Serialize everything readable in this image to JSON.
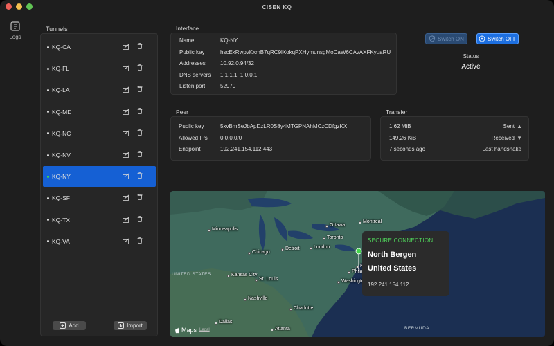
{
  "app": {
    "title": "CISEN KQ"
  },
  "sidebar": {
    "logs_label": "Logs"
  },
  "tunnels": {
    "label": "Tunnels",
    "items": [
      {
        "name": "KQ-CA",
        "active": false
      },
      {
        "name": "KQ-FL",
        "active": false
      },
      {
        "name": "KQ-LA",
        "active": false
      },
      {
        "name": "KQ-MD",
        "active": false
      },
      {
        "name": "KQ-NC",
        "active": false
      },
      {
        "name": "KQ-NV",
        "active": false
      },
      {
        "name": "KQ-NY",
        "active": true
      },
      {
        "name": "KQ-SF",
        "active": false
      },
      {
        "name": "KQ-TX",
        "active": false
      },
      {
        "name": "KQ-VA",
        "active": false
      }
    ],
    "add_label": "Add",
    "import_label": "Import"
  },
  "interface": {
    "label": "Interface",
    "rows": [
      {
        "key": "Name",
        "value": "KQ-NY"
      },
      {
        "key": "Public key",
        "value": "hscEkRwpvKxmB7qRC9lXokqPXHymunsgMoCaW6CAvAXFKyuaRU"
      },
      {
        "key": "Addresses",
        "value": "10.92.0.94/32"
      },
      {
        "key": "DNS servers",
        "value": "1.1.1.1, 1.0.0.1"
      },
      {
        "key": "Listen port",
        "value": "52970"
      }
    ]
  },
  "controls": {
    "switch_on_label": "Switch ON",
    "switch_off_label": "Switch OFF",
    "status_label": "Status",
    "status_value": "Active"
  },
  "peer": {
    "label": "Peer",
    "rows": [
      {
        "key": "Public key",
        "value": "5xvBmSeJbApDzLR0S8y4MTGPNAhMCzCDfgzKX"
      },
      {
        "key": "Allowed IPs",
        "value": "0.0.0.0/0"
      },
      {
        "key": "Endpoint",
        "value": "192.241.154.112:443"
      }
    ]
  },
  "transfer": {
    "label": "Transfer",
    "rows": [
      {
        "value": "1.62 MiB",
        "key": "Sent",
        "arrow": "▲"
      },
      {
        "value": "149.26 KiB",
        "key": "Received",
        "arrow": "▼"
      },
      {
        "value": "7 seconds ago",
        "key": "Last handshake",
        "arrow": ""
      }
    ]
  },
  "map": {
    "cities": [
      "Minneapolis",
      "Ottawa",
      "Montreal",
      "Toronto",
      "Detroit",
      "London",
      "Chicago",
      "Kansas City",
      "St. Louis",
      "Nashville",
      "Charlotte",
      "Dallas",
      "Atlanta",
      "Boston",
      "New York",
      "Philadelphia",
      "Washington"
    ],
    "regions": [
      "UNITED STATES",
      "BERMUDA"
    ],
    "callout": {
      "status": "SECURE CONNECTION",
      "city": "North Bergen",
      "country": "United States",
      "ip": "192.241.154.112"
    },
    "maps_label": "Maps",
    "legal_label": "Legal"
  },
  "colors": {
    "accent": "#1560d4",
    "secure": "#4fd25a",
    "ocean": "#1b2f52",
    "land": "#3f6a5d"
  }
}
